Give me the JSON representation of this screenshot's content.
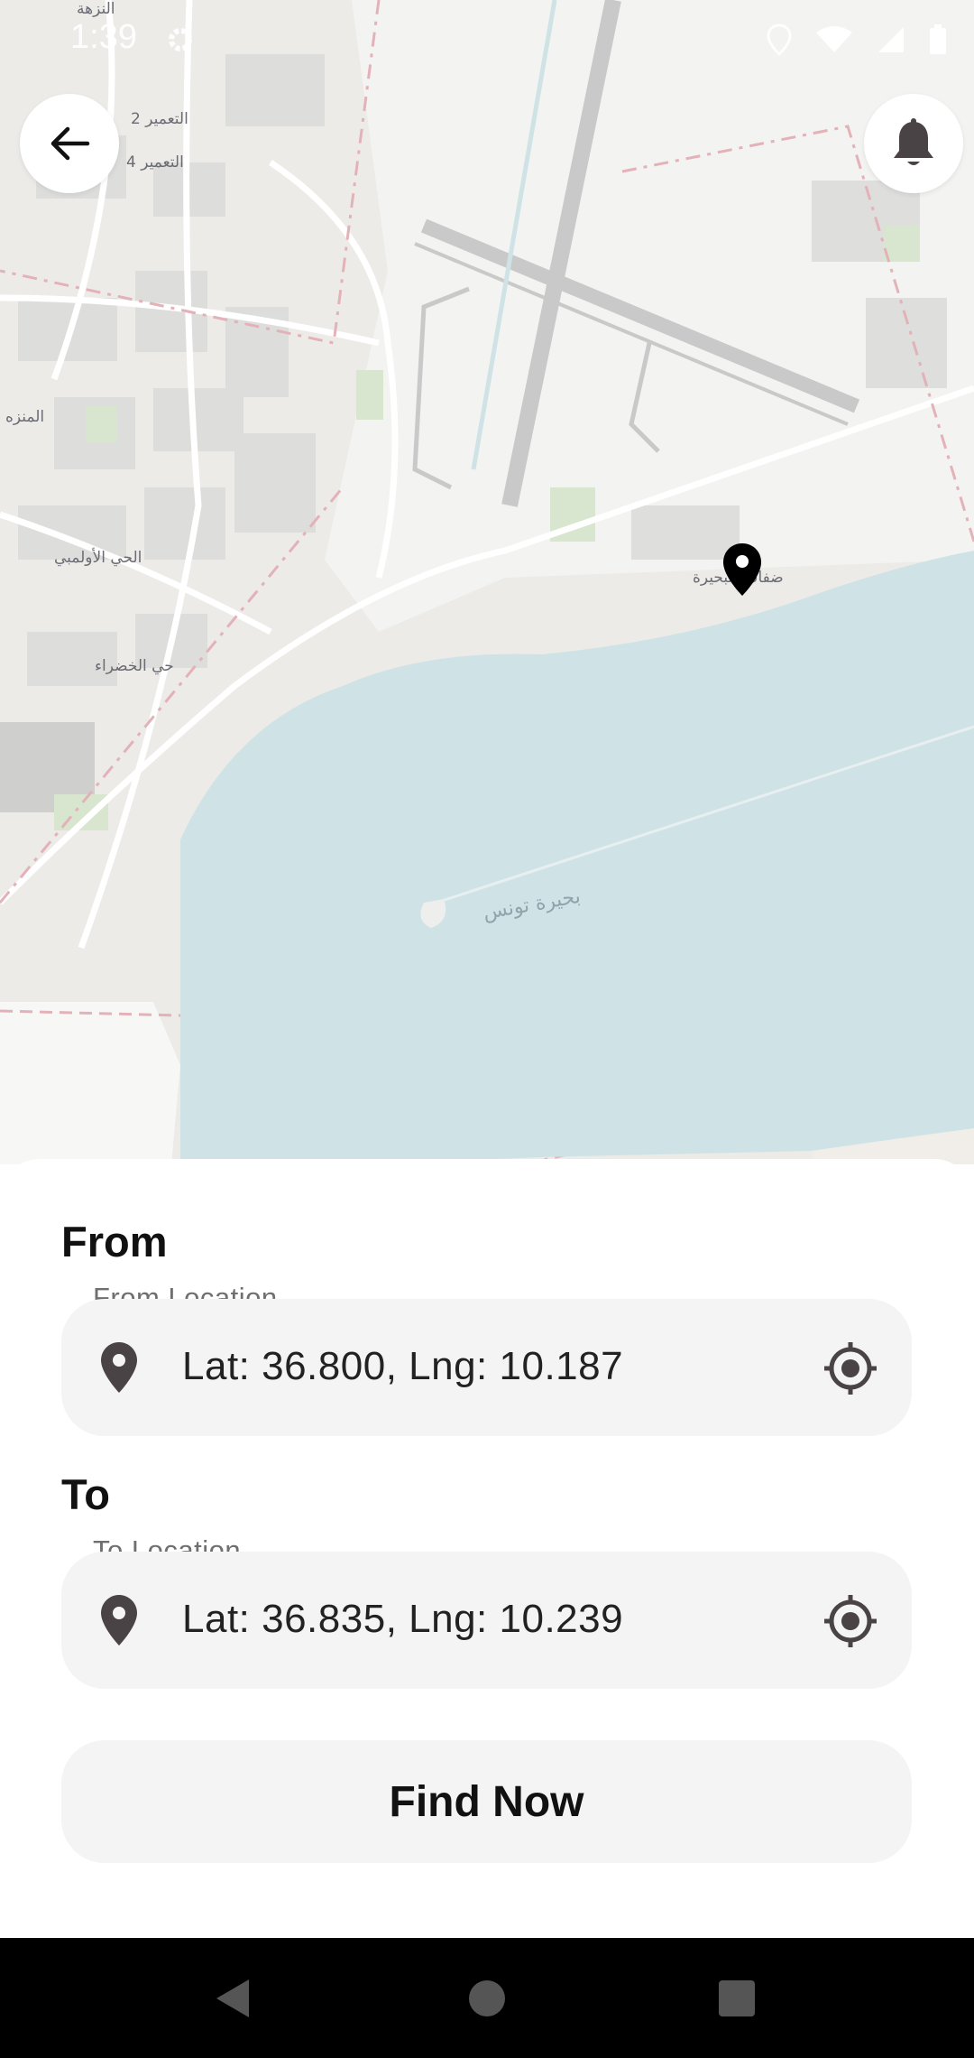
{
  "status_bar": {
    "time": "1:39"
  },
  "map": {
    "labels": {
      "a": "التعمير 2",
      "b": "التعمير 4",
      "c": "المنزه",
      "d": "الحي الأولمبي",
      "e": "حي الخضراء",
      "f": "ضفاف البحيرة",
      "g": "النزهة",
      "lake": "بحيرة تونس"
    }
  },
  "from": {
    "title": "From",
    "field_label": "From Location",
    "value": "Lat: 36.800, Lng: 10.187"
  },
  "to": {
    "title": "To",
    "field_label": "To Location",
    "value": "Lat: 36.835, Lng: 10.239"
  },
  "actions": {
    "find_label": "Find Now"
  },
  "icons": {
    "back": "arrow-left-icon",
    "notifications": "bell-icon",
    "marker": "map-marker-icon",
    "location": "location-pin-icon",
    "gps": "crosshair-gps-icon"
  },
  "colors": {
    "water": "#cfe3e6",
    "field_bg": "#f4f4f4",
    "icon": "#4a4346"
  }
}
